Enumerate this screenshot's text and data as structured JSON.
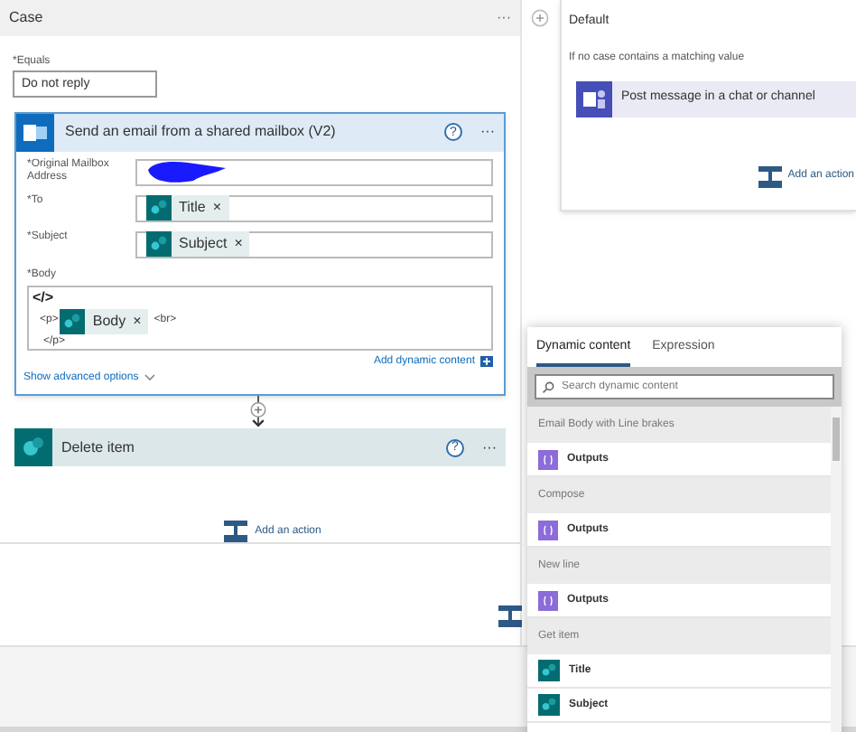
{
  "case": {
    "title": "Case",
    "more": "···",
    "equals_label": "*Equals",
    "equals_value": "Do not reply",
    "email_action": {
      "title": "Send an email from a shared mailbox (V2)",
      "help": "?",
      "more": "···",
      "fields": [
        {
          "label": "*Original Mailbox Address",
          "kind": "redacted"
        },
        {
          "label": "*To",
          "kind": "tokens",
          "tokens": [
            {
              "label": "Title",
              "remove": "×"
            }
          ]
        },
        {
          "label": "*Subject",
          "kind": "tokens",
          "tokens": [
            {
              "label": "Subject",
              "remove": "×"
            }
          ]
        }
      ],
      "body": {
        "label": "*Body",
        "code_toggle": "</>",
        "open_tag": "<p>",
        "token": {
          "label": "Body",
          "remove": "×"
        },
        "br_tag": "<br>",
        "close_tag": "</p>"
      },
      "add_dynamic": "Add dynamic content",
      "show_advanced": "Show advanced options"
    },
    "delete_action": {
      "title": "Delete item",
      "help": "?",
      "more": "···"
    },
    "add_action": "Add an action"
  },
  "default": {
    "title": "Default",
    "description": "If no case contains a matching value",
    "action": {
      "title": "Post message in a chat or channel"
    },
    "add_action": "Add an action"
  },
  "dynamic_panel": {
    "tabs": [
      {
        "label": "Dynamic content",
        "selected": true
      },
      {
        "label": "Expression",
        "selected": false
      }
    ],
    "search": {
      "placeholder": "Search dynamic content"
    },
    "items": [
      {
        "kind": "header",
        "label": "Email Body with Line brakes"
      },
      {
        "kind": "variable",
        "label": "Outputs"
      },
      {
        "kind": "header",
        "label": "Compose"
      },
      {
        "kind": "variable",
        "label": "Outputs"
      },
      {
        "kind": "header",
        "label": "New line"
      },
      {
        "kind": "variable",
        "label": "Outputs"
      },
      {
        "kind": "header",
        "label": "Get item"
      },
      {
        "kind": "sharepoint",
        "label": "Title"
      },
      {
        "kind": "sharepoint",
        "label": "Subject"
      }
    ]
  }
}
